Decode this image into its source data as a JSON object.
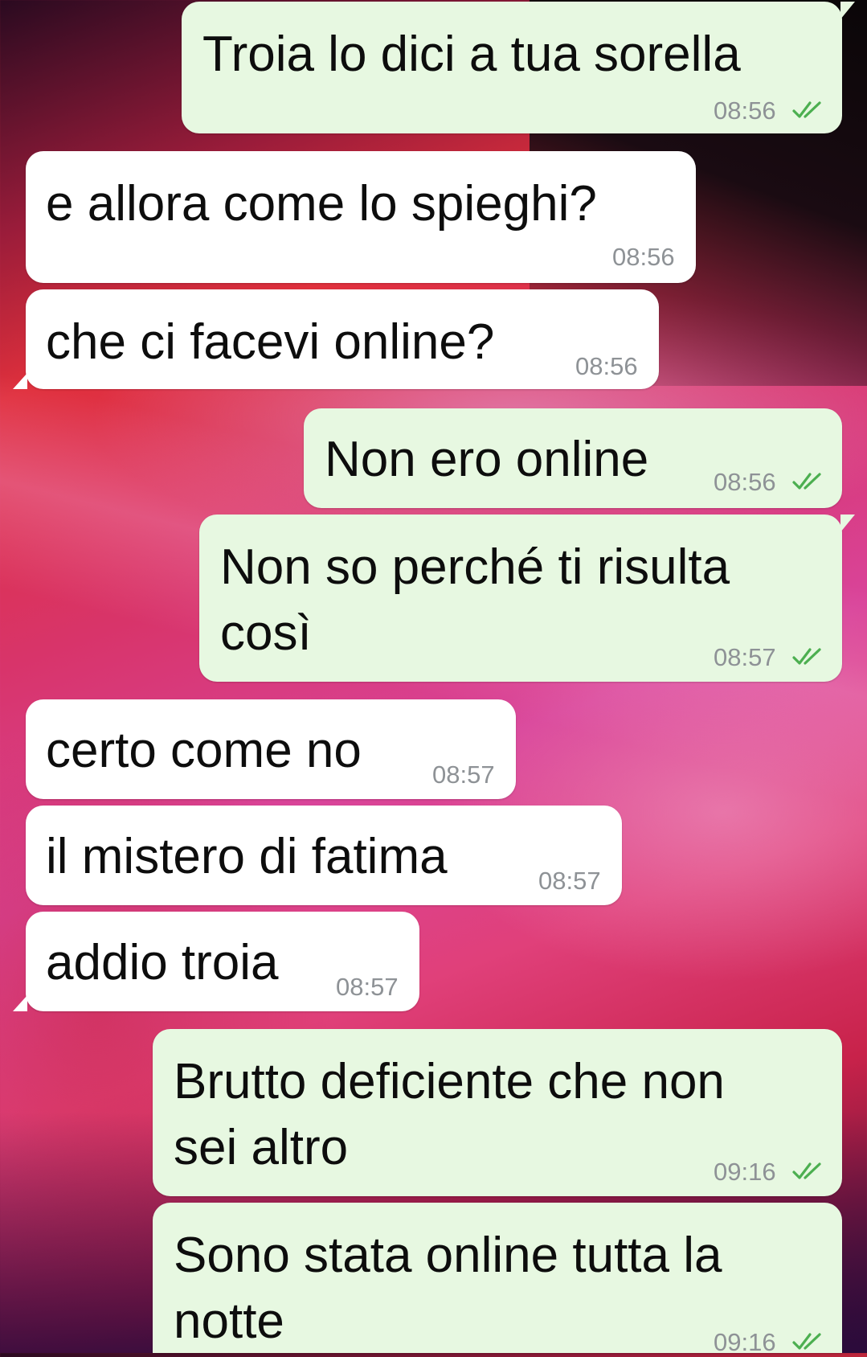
{
  "colors": {
    "incoming_bubble": "#ffffff",
    "outgoing_bubble": "#e7f8e1",
    "timestamp": "#8e9296",
    "read_ticks": "#4caf50"
  },
  "icons": {
    "read_receipt": "double-check-icon"
  },
  "messages": [
    {
      "direction": "outgoing",
      "text": "Troia lo dici a tua sorella",
      "time": "08:56",
      "status": "read"
    },
    {
      "direction": "incoming",
      "text": "e allora come lo spieghi?",
      "time": "08:56"
    },
    {
      "direction": "incoming",
      "text": "che ci facevi online?",
      "time": "08:56"
    },
    {
      "direction": "outgoing",
      "text": "Non ero online",
      "time": "08:56",
      "status": "read"
    },
    {
      "direction": "outgoing",
      "text_line1": "Non so perché ti risulta",
      "text_line2": "così",
      "time": "08:57",
      "status": "read"
    },
    {
      "direction": "incoming",
      "text": "certo come no",
      "time": "08:57"
    },
    {
      "direction": "incoming",
      "text": "il mistero di fatima",
      "time": "08:57"
    },
    {
      "direction": "incoming",
      "text": "addio troia",
      "time": "08:57"
    },
    {
      "direction": "outgoing",
      "text_line1": "Brutto deficiente che non",
      "text_line2": "sei altro",
      "time": "09:16",
      "status": "read"
    },
    {
      "direction": "outgoing",
      "text_line1": "Sono stata online tutta la",
      "text_line2": "notte",
      "time": "09:16",
      "status": "read"
    }
  ]
}
